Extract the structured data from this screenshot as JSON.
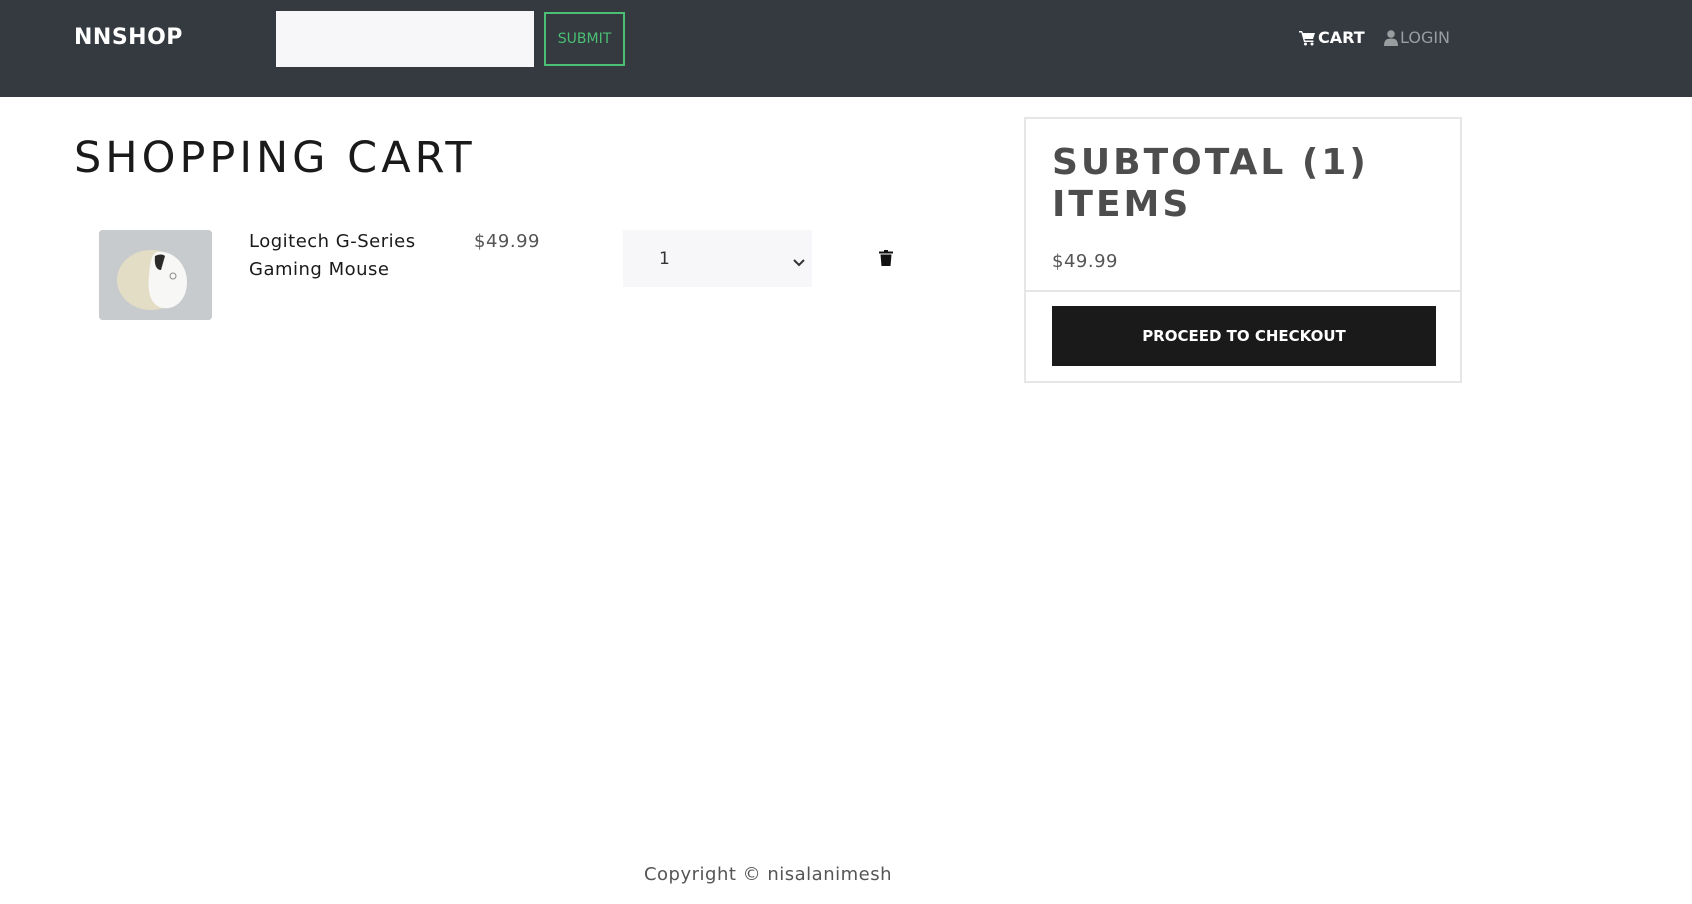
{
  "navbar": {
    "brand": "NNSHOP",
    "search_placeholder": "",
    "submit_label": "SUBMIT",
    "cart_label": "CART",
    "login_label": "LOGIN"
  },
  "page": {
    "title": "SHOPPING CART"
  },
  "cart": {
    "items": [
      {
        "name": "Logitech G-Series Gaming Mouse",
        "price": "$49.99",
        "quantity": "1",
        "image_icon": "mouse-product-image"
      }
    ]
  },
  "summary": {
    "title": "SUBTOTAL (1) ITEMS",
    "amount": "$49.99",
    "checkout_label": "PROCEED TO CHECKOUT"
  },
  "footer": {
    "copyright": "Copyright © nisalanimesh"
  },
  "colors": {
    "navbar_bg": "#343a40",
    "accent_green": "#4bbf73",
    "checkout_bg": "#1a1a1a"
  }
}
